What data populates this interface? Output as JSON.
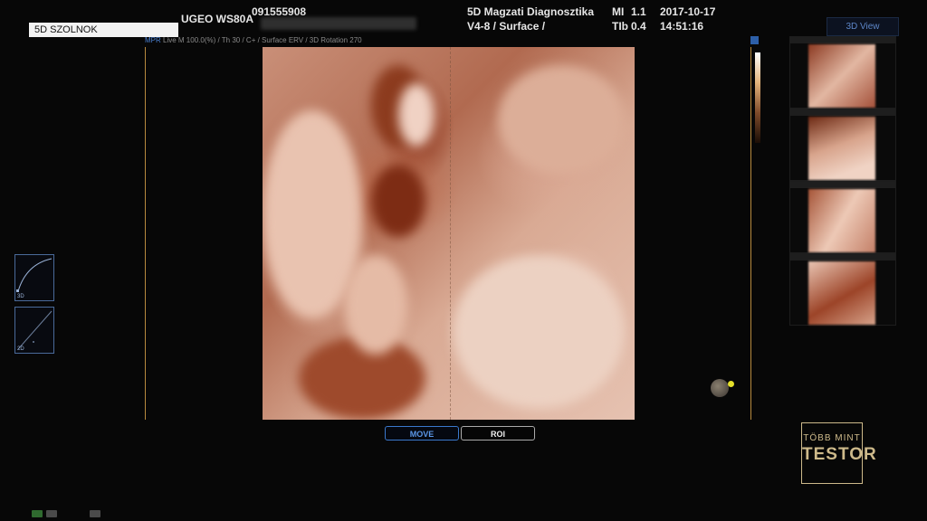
{
  "header": {
    "location_label": "5D SZOLNOK",
    "device": "UGEO WS80A",
    "patient_id": "091555908",
    "clinic": "5D Magzati Diagnosztika",
    "probe": "V4-8 / Surface /",
    "mi_label": "MI",
    "mi_value": "1.1",
    "tib_label": "TIb",
    "tib_value": "0.4",
    "date": "2017-10-17",
    "time": "14:51:16",
    "view_button": "3D View"
  },
  "status": {
    "mode": "MPR",
    "params": "Live  M 100.0(%) / Th 30 / C+ / Surface ERV / 3D Rotation 270"
  },
  "mini_panels": [
    {
      "label": "3D"
    },
    {
      "label": "2D"
    }
  ],
  "toolbar": {
    "move_label": "MOVE",
    "roi_label": "ROI"
  },
  "logo": {
    "line1": "TÖBB MINT",
    "line2": "TESTOR"
  },
  "colors": {
    "accent_blue": "#3a78cc",
    "viewport_border": "#b88a3e",
    "logo_gold": "#cdb98a",
    "cursor_yellow": "#e5e02a"
  },
  "icons": [
    "bottom-status-icon",
    "bottom-monitor-icon",
    "bottom-keyboard-icon",
    "trackball-icon"
  ]
}
